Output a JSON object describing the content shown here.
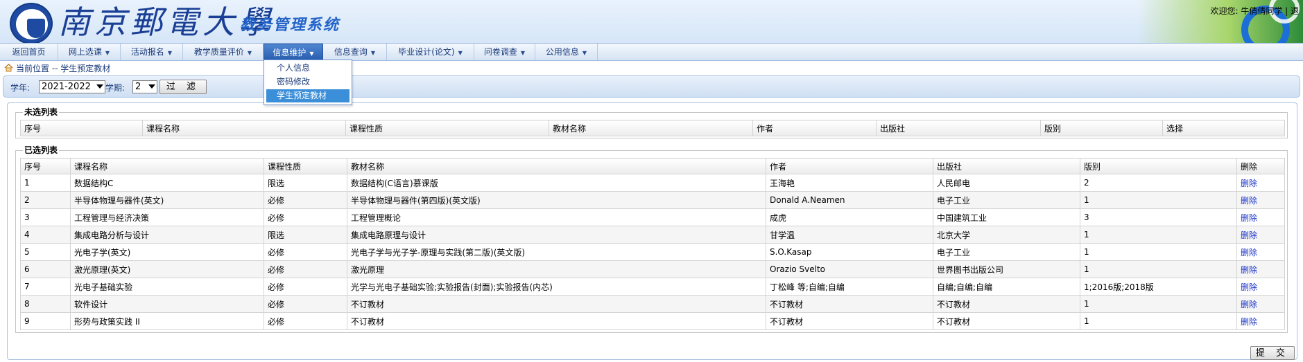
{
  "header": {
    "school_name": "南京郵電大學",
    "system_title": "教务管理系统",
    "welcome_text": "欢迎您:  牛倩倩同学 | 退"
  },
  "menu": [
    {
      "label": "返回首页",
      "has_caret": false
    },
    {
      "label": "网上选课",
      "has_caret": true
    },
    {
      "label": "活动报名",
      "has_caret": true
    },
    {
      "label": "教学质量评价",
      "has_caret": true
    },
    {
      "label": "信息维护",
      "has_caret": true,
      "active": true
    },
    {
      "label": "信息查询",
      "has_caret": true
    },
    {
      "label": "毕业设计(论文)",
      "has_caret": true
    },
    {
      "label": "问卷调查",
      "has_caret": true
    },
    {
      "label": "公用信息",
      "has_caret": true
    }
  ],
  "dropdown": {
    "items": [
      "个人信息",
      "密码修改",
      "学生预定教材"
    ],
    "selected": "学生预定教材"
  },
  "breadcrumb": "当前位置 -- 学生预定教材",
  "filter": {
    "year_label": "学年:",
    "year_value": "2021-2022",
    "term_label": "学期:",
    "term_value": "2",
    "filter_button": "过 滤"
  },
  "unselected": {
    "title": "未选列表",
    "headers": [
      "序号",
      "课程名称",
      "课程性质",
      "教材名称",
      "作者",
      "出版社",
      "版别",
      "选择"
    ]
  },
  "selected": {
    "title": "已选列表",
    "headers": [
      "序号",
      "课程名称",
      "课程性质",
      "教材名称",
      "作者",
      "出版社",
      "版别",
      "删除"
    ],
    "rows": [
      [
        "1",
        "数据结构C",
        "限选",
        "数据结构(C语言)慕课版",
        "王海艳",
        "人民邮电",
        "2",
        "删除"
      ],
      [
        "2",
        "半导体物理与器件(英文)",
        "必修",
        "半导体物理与器件(第四版)(英文版)",
        "Donald A.Neamen",
        "电子工业",
        "1",
        "删除"
      ],
      [
        "3",
        "工程管理与经济决策",
        "必修",
        "工程管理概论",
        "成虎",
        "中国建筑工业",
        "3",
        "删除"
      ],
      [
        "4",
        "集成电路分析与设计",
        "限选",
        "集成电路原理与设计",
        "甘学温",
        "北京大学",
        "1",
        "删除"
      ],
      [
        "5",
        "光电子学(英文)",
        "必修",
        "光电子学与光子学-原理与实践(第二版)(英文版)",
        "S.O.Kasap",
        "电子工业",
        "1",
        "删除"
      ],
      [
        "6",
        "激光原理(英文)",
        "必修",
        "激光原理",
        "Orazio Svelto",
        "世界图书出版公司",
        "1",
        "删除"
      ],
      [
        "7",
        "光电子基础实验",
        "必修",
        "光学与光电子基础实验;实验报告(封面);实验报告(内芯)",
        "丁松峰 等;自编;自编",
        "自编;自编;自编",
        "1;2016版;2018版",
        "删除"
      ],
      [
        "8",
        "软件设计",
        "必修",
        "不订教材",
        "不订教材",
        "不订教材",
        "1",
        "删除"
      ],
      [
        "9",
        "形势与政策实践 II",
        "必修",
        "不订教材",
        "不订教材",
        "不订教材",
        "1",
        "删除"
      ]
    ]
  },
  "submit_button": "提 交",
  "colors": {
    "brand_blue": "#1a3f95",
    "menu_active": "#2a5fb0",
    "link_blue": "#1a33c8"
  }
}
